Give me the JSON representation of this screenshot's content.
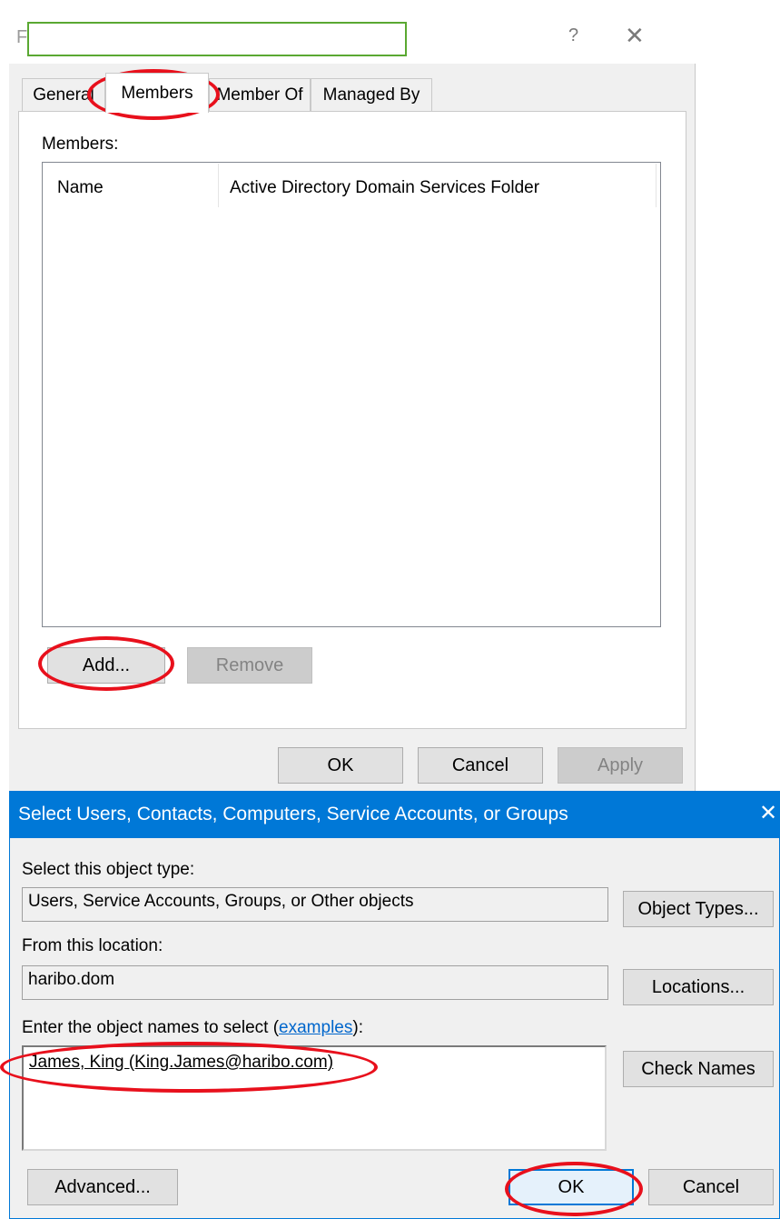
{
  "properties_dialog": {
    "title_initial": "F",
    "help_glyph": "?",
    "close_glyph": "✕",
    "tabs": [
      {
        "label": "General"
      },
      {
        "label": "Members"
      },
      {
        "label": "Member Of"
      },
      {
        "label": "Managed By"
      }
    ],
    "members_label": "Members:",
    "columns": [
      "Name",
      "Active Directory Domain Services Folder"
    ],
    "add_label": "Add...",
    "remove_label": "Remove",
    "ok_label": "OK",
    "cancel_label": "Cancel",
    "apply_label": "Apply"
  },
  "select_dialog": {
    "title": "Select Users, Contacts, Computers, Service Accounts, or Groups",
    "close_glyph": "✕",
    "object_type_label": "Select this object type:",
    "object_type_value": "Users, Service Accounts, Groups, or Other objects",
    "object_types_button": "Object Types...",
    "location_label": "From this location:",
    "location_value": "haribo.dom",
    "locations_button": "Locations...",
    "enter_label": "Enter the object names to select (",
    "examples_link": "examples",
    "enter_label_end": "):",
    "names_value": "James, King (King.James@haribo.com)",
    "check_names_button": "Check Names",
    "advanced_button": "Advanced...",
    "ok_button": "OK",
    "cancel_button": "Cancel"
  },
  "colors": {
    "accent": "#0078d7",
    "annotation": "#e8101c",
    "redaction_border": "#5aa832"
  }
}
